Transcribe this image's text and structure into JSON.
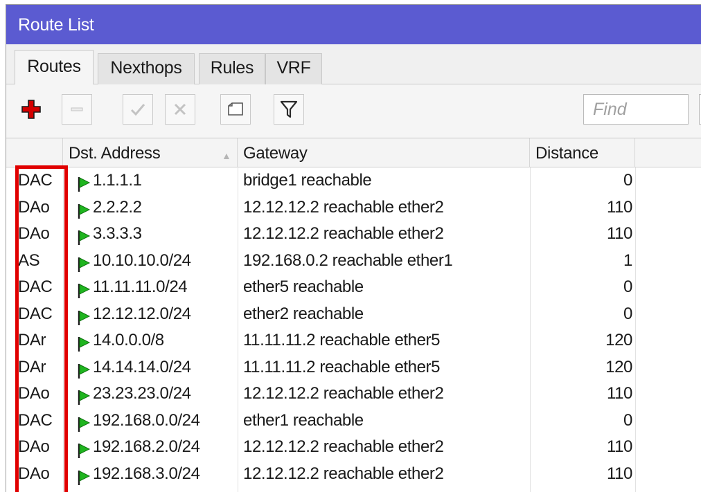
{
  "window": {
    "title": "Route List"
  },
  "tabs": [
    {
      "label": "Routes",
      "active": true
    },
    {
      "label": "Nexthops",
      "active": false
    },
    {
      "label": "Rules",
      "active": false
    },
    {
      "label": "VRF",
      "active": false
    }
  ],
  "toolbar": {
    "buttons": [
      {
        "name": "add-button",
        "icon": "plus-icon",
        "enabled": true
      },
      {
        "name": "remove-button",
        "icon": "minus-icon",
        "enabled": false
      },
      {
        "name": "enable-button",
        "icon": "checkmark-icon",
        "enabled": false
      },
      {
        "name": "disable-button",
        "icon": "cross-icon",
        "enabled": false
      },
      {
        "name": "comment-button",
        "icon": "note-icon",
        "enabled": true
      },
      {
        "name": "filter-button",
        "icon": "filter-icon",
        "enabled": true
      }
    ],
    "find_placeholder": "Find",
    "extra_select_value": "a"
  },
  "table": {
    "columns": [
      "",
      "Dst. Address",
      "Gateway",
      "Distance"
    ],
    "rows": [
      {
        "flags": "DAC",
        "dst": "1.1.1.1",
        "gateway": "bridge1 reachable",
        "distance": "0"
      },
      {
        "flags": "DAo",
        "dst": "2.2.2.2",
        "gateway": "12.12.12.2 reachable ether2",
        "distance": "110"
      },
      {
        "flags": "DAo",
        "dst": "3.3.3.3",
        "gateway": "12.12.12.2 reachable ether2",
        "distance": "110"
      },
      {
        "flags": "AS",
        "dst": "10.10.10.0/24",
        "gateway": "192.168.0.2 reachable ether1",
        "distance": "1"
      },
      {
        "flags": "DAC",
        "dst": "11.11.11.0/24",
        "gateway": "ether5 reachable",
        "distance": "0"
      },
      {
        "flags": "DAC",
        "dst": "12.12.12.0/24",
        "gateway": "ether2 reachable",
        "distance": "0"
      },
      {
        "flags": "DAr",
        "dst": "14.0.0.0/8",
        "gateway": "11.11.11.2 reachable ether5",
        "distance": "120"
      },
      {
        "flags": "DAr",
        "dst": "14.14.14.0/24",
        "gateway": "11.11.11.2 reachable ether5",
        "distance": "120"
      },
      {
        "flags": "DAo",
        "dst": "23.23.23.0/24",
        "gateway": "12.12.12.2 reachable ether2",
        "distance": "110"
      },
      {
        "flags": "DAC",
        "dst": "192.168.0.0/24",
        "gateway": "ether1 reachable",
        "distance": "0"
      },
      {
        "flags": "DAo",
        "dst": "192.168.2.0/24",
        "gateway": "12.12.12.2 reachable ether2",
        "distance": "110"
      },
      {
        "flags": "DAo",
        "dst": "192.168.3.0/24",
        "gateway": "12.12.12.2 reachable ether2",
        "distance": "110"
      }
    ],
    "row_icon": "green-flag-icon"
  },
  "colors": {
    "titlebar": "#5b5bd1",
    "highlight": "#e00000",
    "flag_green": "#1fb51f",
    "add_red": "#d40000"
  }
}
